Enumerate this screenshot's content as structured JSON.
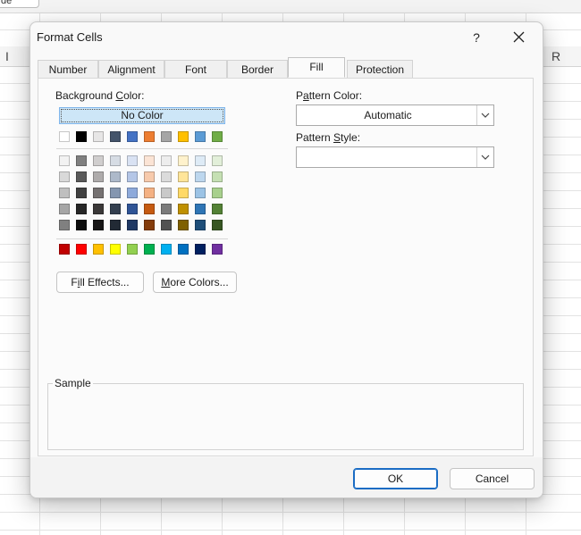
{
  "sheet": {
    "tab_fragment": "de",
    "col_left": "I",
    "col_right": "R"
  },
  "dialog": {
    "title": "Format Cells",
    "help_glyph": "?",
    "tabs": [
      {
        "label": "Number"
      },
      {
        "label": "Alignment"
      },
      {
        "label": "Font"
      },
      {
        "label": "Border"
      },
      {
        "label": "Fill",
        "active": true
      },
      {
        "label": "Protection"
      }
    ]
  },
  "fill": {
    "bg_label_pre": "Background ",
    "bg_label_ul": "C",
    "bg_label_post": "olor:",
    "no_color": "No Color",
    "theme_row": [
      "#ffffff",
      "#000000",
      "#e7e6e6",
      "#44546a",
      "#4472c4",
      "#ed7d31",
      "#a5a5a5",
      "#ffc000",
      "#5b9bd5",
      "#70ad47"
    ],
    "theme_shades": [
      [
        "#f2f2f2",
        "#808080",
        "#d0cece",
        "#d6dce4",
        "#d9e2f3",
        "#fbe4d5",
        "#ededed",
        "#fff2cc",
        "#deebf6",
        "#e2efd9"
      ],
      [
        "#d9d9d9",
        "#595959",
        "#aeabab",
        "#adb9ca",
        "#b4c6e7",
        "#f7caac",
        "#dbdbdb",
        "#ffe599",
        "#bdd7ee",
        "#c5e0b3"
      ],
      [
        "#bfbfbf",
        "#404040",
        "#757171",
        "#8496b0",
        "#8eaadb",
        "#f4b183",
        "#c9c9c9",
        "#ffd966",
        "#9cc3e5",
        "#a8d08d"
      ],
      [
        "#a6a6a6",
        "#262626",
        "#3a3838",
        "#333f4f",
        "#2f5496",
        "#c55a11",
        "#7b7b7b",
        "#bf9000",
        "#2e75b5",
        "#538135"
      ],
      [
        "#808080",
        "#0d0d0d",
        "#171616",
        "#222a35",
        "#1f3864",
        "#843c0b",
        "#525252",
        "#7f6000",
        "#1e4e79",
        "#375623"
      ]
    ],
    "standard_row": [
      "#c00000",
      "#ff0000",
      "#ffc000",
      "#ffff00",
      "#92d050",
      "#00b050",
      "#00b0f0",
      "#0070c0",
      "#002060",
      "#7030a0"
    ],
    "fill_effects_btn": {
      "pre": "F",
      "ul": "i",
      "post": "ll Effects..."
    },
    "more_colors_btn": {
      "ul": "M",
      "post": "ore Colors..."
    },
    "pattern_color_label": {
      "pre": "P",
      "ul": "a",
      "post": "ttern Color:"
    },
    "pattern_color_value": "Automatic",
    "pattern_style_label": {
      "pre": "Pattern ",
      "ul": "S",
      "post": "tyle:"
    },
    "pattern_style_value": "",
    "sample_label": "Sample"
  },
  "footer": {
    "ok": "OK",
    "cancel": "Cancel"
  }
}
